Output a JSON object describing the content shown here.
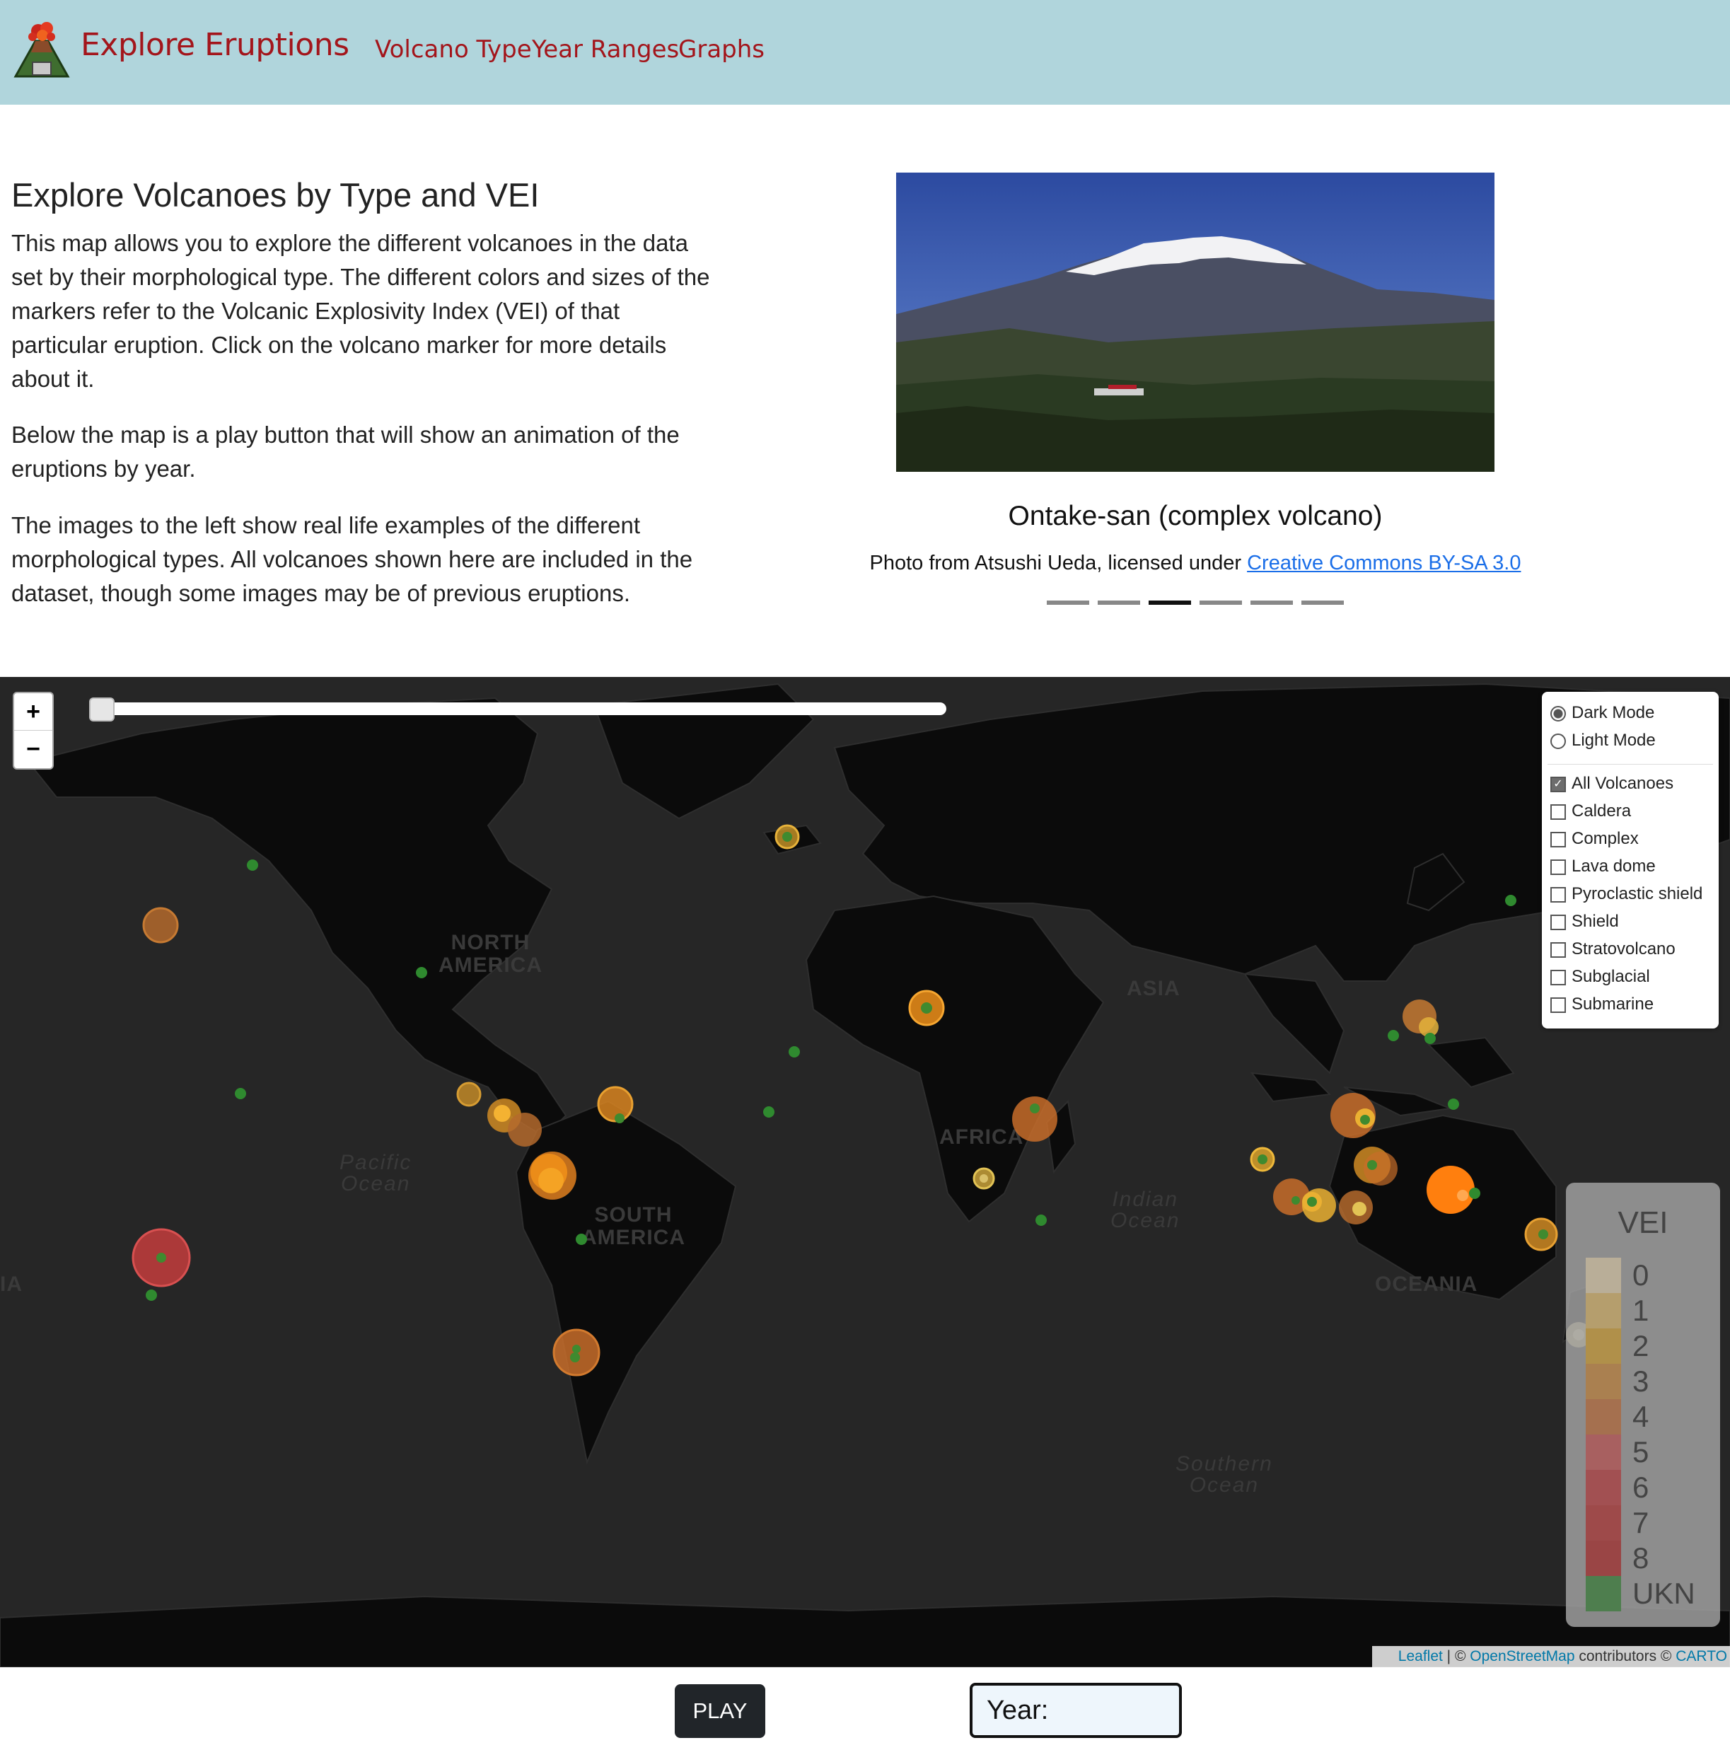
{
  "navbar": {
    "brand": "Explore Eruptions",
    "links": [
      "Volcano Type",
      "Year Ranges",
      "Graphs"
    ]
  },
  "intro": {
    "title": "Explore Volcanoes by Type and VEI",
    "paragraphs": [
      "This map allows you to explore the different volcanoes in the data set by their morphological type. The different colors and sizes of the markers refer to the Volcanic Explosivity Index (VEI) of that particular eruption. Click on the volcano marker for more details about it.",
      "Below the map is a play button that will show an animation of the eruptions by year.",
      "The images to the left show real life examples of the different morphological types. All volcanoes shown here are included in the dataset, though some images may be of previous eruptions."
    ]
  },
  "carousel": {
    "caption_title": "Ontake-san (complex volcano)",
    "credit_prefix": "Photo from Atsushi Ueda, licensed under ",
    "credit_link": "Creative Commons BY-SA 3.0",
    "slide_count": 6,
    "active_index": 2
  },
  "map": {
    "zoom_in": "+",
    "zoom_out": "−",
    "labels": {
      "north_america": [
        "NORTH",
        "AMERICA"
      ],
      "south_america": [
        "SOUTH",
        "AMERICA"
      ],
      "asia": "ASIA",
      "africa": "AFRICA",
      "oceania": "OCEANIA",
      "asia_edge": "IA",
      "pacific": [
        "Pacific",
        "Ocean"
      ],
      "indian": [
        "Indian",
        "Ocean"
      ],
      "southern": [
        "Southern",
        "Ocean"
      ]
    },
    "basemaps": [
      {
        "label": "Dark Mode",
        "selected": true
      },
      {
        "label": "Light Mode",
        "selected": false
      }
    ],
    "overlays": [
      {
        "label": "All Volcanoes",
        "checked": true
      },
      {
        "label": "Caldera",
        "checked": false
      },
      {
        "label": "Complex",
        "checked": false
      },
      {
        "label": "Lava dome",
        "checked": false
      },
      {
        "label": "Pyroclastic shield",
        "checked": false
      },
      {
        "label": "Shield",
        "checked": false
      },
      {
        "label": "Stratovolcano",
        "checked": false
      },
      {
        "label": "Subglacial",
        "checked": false
      },
      {
        "label": "Submarine",
        "checked": false
      }
    ],
    "legend": {
      "title": "VEI",
      "items": [
        {
          "label": "0",
          "color": "#b9ae98"
        },
        {
          "label": "1",
          "color": "#b59e6d"
        },
        {
          "label": "2",
          "color": "#b0904a"
        },
        {
          "label": "3",
          "color": "#aa8050"
        },
        {
          "label": "4",
          "color": "#a5704f"
        },
        {
          "label": "5",
          "color": "#a86060"
        },
        {
          "label": "6",
          "color": "#a25052"
        },
        {
          "label": "7",
          "color": "#9e4a4a"
        },
        {
          "label": "8",
          "color": "#9a4545"
        },
        {
          "label": "UKN",
          "color": "#4e7e4e"
        }
      ]
    },
    "attribution": {
      "leaflet": "Leaflet",
      "sep": " | © ",
      "osm": "OpenStreetMap",
      "mid": " contributors © ",
      "carto": "CARTO"
    }
  },
  "controls": {
    "play_label": "PLAY",
    "year_label": "Year:"
  }
}
